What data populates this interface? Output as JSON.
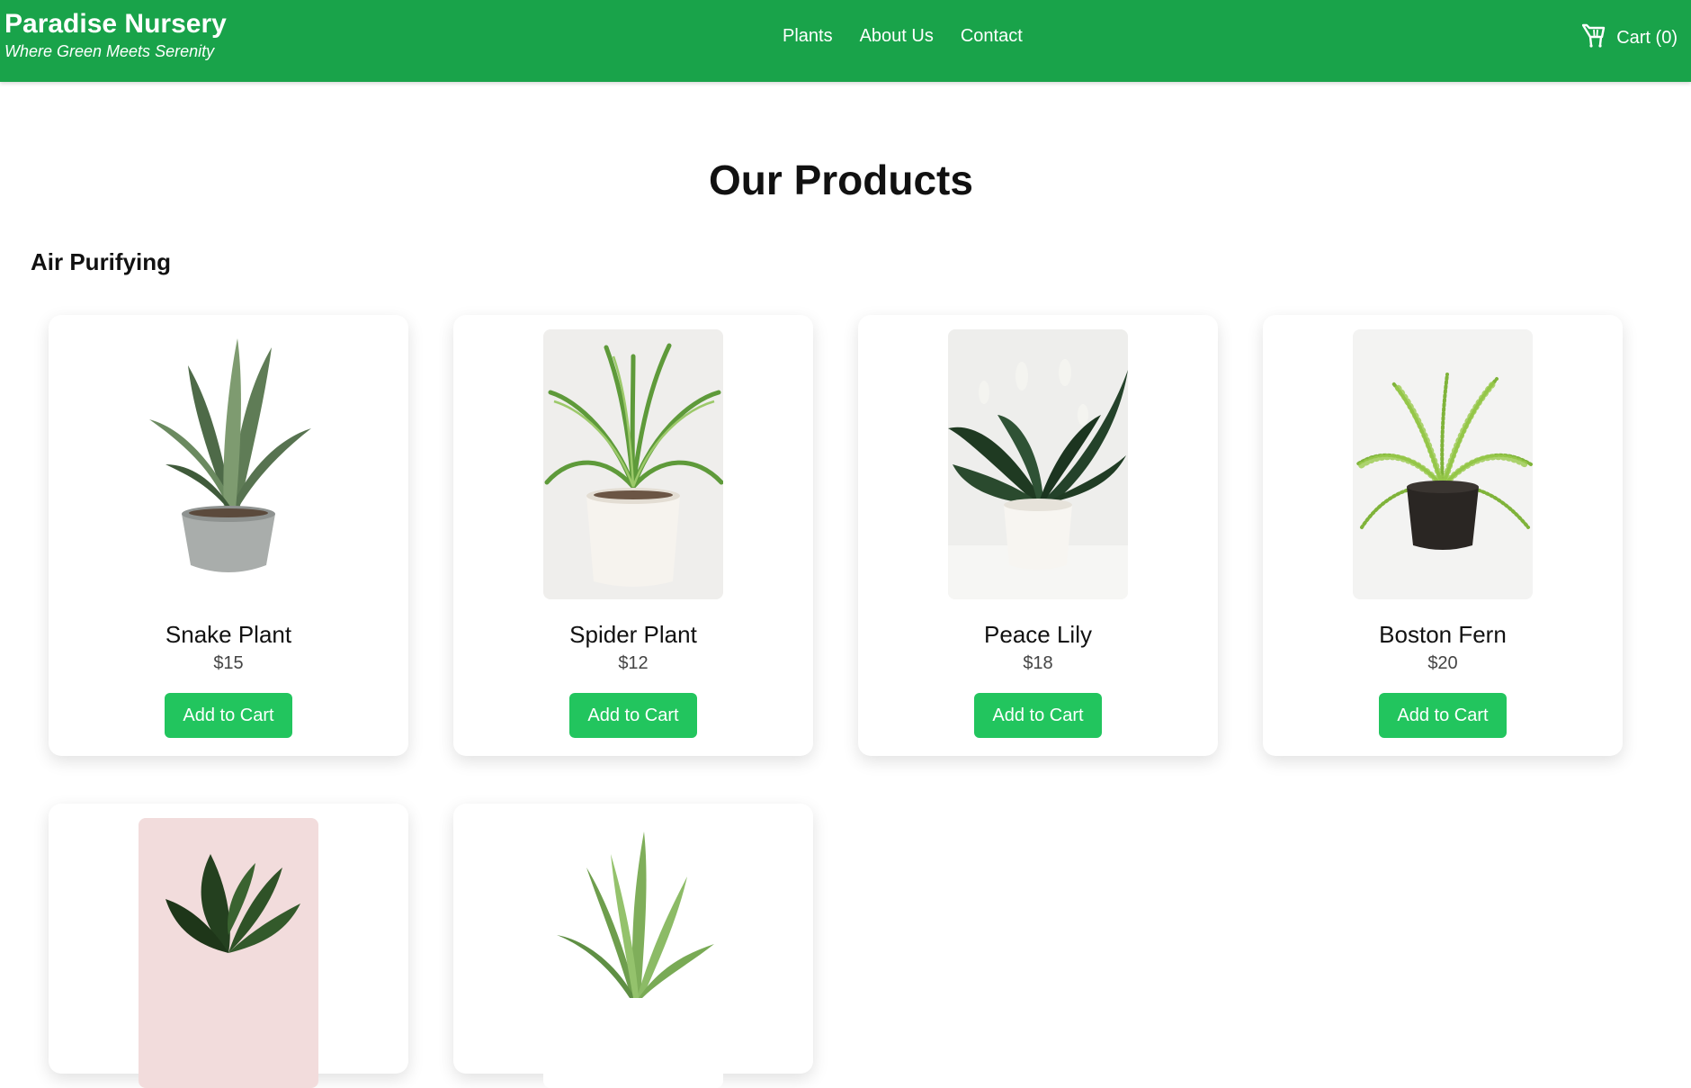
{
  "header": {
    "brand_name": "Paradise Nursery",
    "tagline": "Where Green Meets Serenity",
    "nav": [
      {
        "label": "Plants"
      },
      {
        "label": "About Us"
      },
      {
        "label": "Contact"
      }
    ],
    "cart_label": "Cart (0)",
    "cart_icon": "shopping-cart-icon"
  },
  "main": {
    "title": "Our Products",
    "section": "Air Purifying",
    "products": [
      {
        "name": "Snake Plant",
        "price": "$15",
        "button": "Add to Cart"
      },
      {
        "name": "Spider Plant",
        "price": "$12",
        "button": "Add to Cart"
      },
      {
        "name": "Peace Lily",
        "price": "$18",
        "button": "Add to Cart"
      },
      {
        "name": "Boston Fern",
        "price": "$20",
        "button": "Add to Cart"
      }
    ]
  },
  "colors": {
    "header_bg": "#19a34a",
    "button_bg": "#22c55e",
    "text": "#111111"
  }
}
